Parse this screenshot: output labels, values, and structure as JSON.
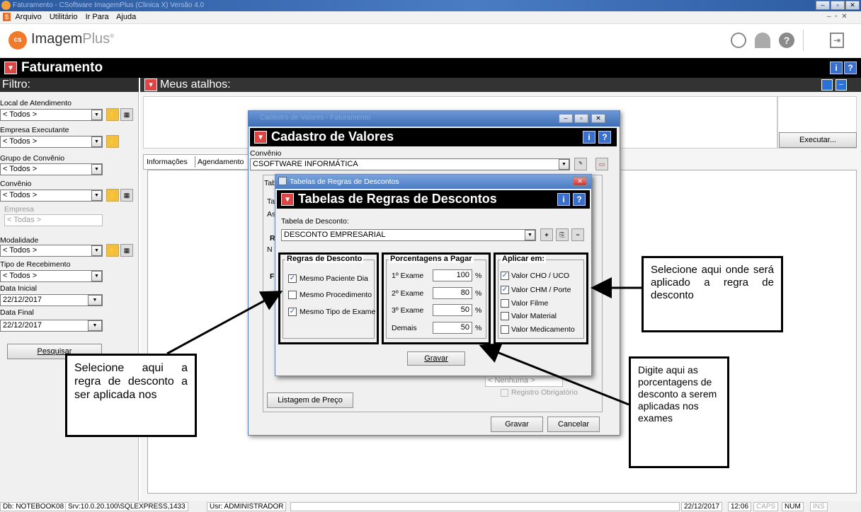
{
  "window": {
    "title": "Faturamento - CSoftware ImagemPlus (Clinica X)  Versão 4.0",
    "min": "–",
    "max": "▫",
    "close": "✕"
  },
  "menu": [
    "Arquivo",
    "Utilitário",
    "Ir Para",
    "Ajuda"
  ],
  "app": {
    "logo_text": "Imagem",
    "logo_plus": "Plus",
    "logo_badge": "cs"
  },
  "module": {
    "title": "Faturamento"
  },
  "filter": {
    "title": "Filtro:",
    "local_label": "Local de Atendimento",
    "local_value": "< Todos >",
    "empresa_exec_label": "Empresa Executante",
    "empresa_exec_value": "< Todos >",
    "grupo_label": "Grupo de Convênio",
    "grupo_value": "< Todos >",
    "convenio_label": "Convênio",
    "convenio_value": "< Todos >",
    "empresa_label": "Empresa",
    "empresa_value": "< Todas >",
    "modalidade_label": "Modalidade",
    "modalidade_value": "< Todos >",
    "tipo_label": "Tipo de Recebimento",
    "tipo_value": "< Todos >",
    "data_ini_label": "Data Inicial",
    "data_ini_value": "22/12/2017",
    "data_fim_label": "Data Final",
    "data_fim_value": "22/12/2017",
    "search_button": "Pesquisar"
  },
  "atalhos": {
    "title": "Meus atalhos:",
    "executar": "Executar..."
  },
  "tabs": [
    "Informações",
    "Agendamento"
  ],
  "cadastro": {
    "window_title": "Cadastro de Valores - Faturamento",
    "title": "Cadastro de Valores",
    "convenio_label": "Convênio",
    "convenio_value": "CSOFTWARE INFORMÁTICA",
    "partial_tab": "Tab",
    "partial_ta": "Ta",
    "partial_as": "As",
    "partial_n": "N",
    "partial_r": "R",
    "partial_f": "F",
    "nenhuma": "< Nenhuma >",
    "registro": "Registro Obrigatório",
    "listagem": "Listagem de Preço",
    "gravar": "Gravar",
    "cancelar": "Cancelar"
  },
  "regras": {
    "window_title": "Tabelas de Regras de Descontos",
    "title": "Tabelas de Regras de Descontos",
    "tabela_label": "Tabela de Desconto:",
    "tabela_value": "DESCONTO EMPRESARIAL",
    "grp_regras": "Regras de Desconto",
    "regras": [
      {
        "label": "Mesmo Paciente Dia",
        "checked": true
      },
      {
        "label": "Mesmo Procedimento",
        "checked": false
      },
      {
        "label": "Mesmo Tipo de Exame",
        "checked": true
      }
    ],
    "grp_porc": "Porcentagens a Pagar",
    "porc": [
      {
        "label": "1º Exame",
        "value": "100",
        "unit": "%"
      },
      {
        "label": "2º Exame",
        "value": "80",
        "unit": "%"
      },
      {
        "label": "3º Exame",
        "value": "50",
        "unit": "%"
      },
      {
        "label": "Demais",
        "value": "50",
        "unit": "%"
      }
    ],
    "grp_aplicar": "Aplicar em:",
    "aplicar": [
      {
        "label": "Valor CHO / UCO",
        "checked": true
      },
      {
        "label": "Valor CHM / Porte",
        "checked": true
      },
      {
        "label": "Valor Filme",
        "checked": false
      },
      {
        "label": "Valor Material",
        "checked": false
      },
      {
        "label": "Valor Medicamento",
        "checked": false
      }
    ],
    "gravar": "Gravar"
  },
  "callouts": {
    "aplicar": "Selecione aqui onde será aplicado a regra de desconto",
    "regra": "Selecione aqui a regra de desconto a ser aplicada nos",
    "porc": "Digite aqui as porcentagens de desconto a serem aplicadas nos exames"
  },
  "status": {
    "db": "Db: NOTEBOOK08",
    "srv": "Srv:10.0.20.100\\SQLEXPRESS,1433",
    "usr": "Usr: ADMINISTRADOR",
    "date": "22/12/2017",
    "time": "12:06",
    "caps": "CAPS",
    "num": "NUM",
    "ins": "INS"
  }
}
